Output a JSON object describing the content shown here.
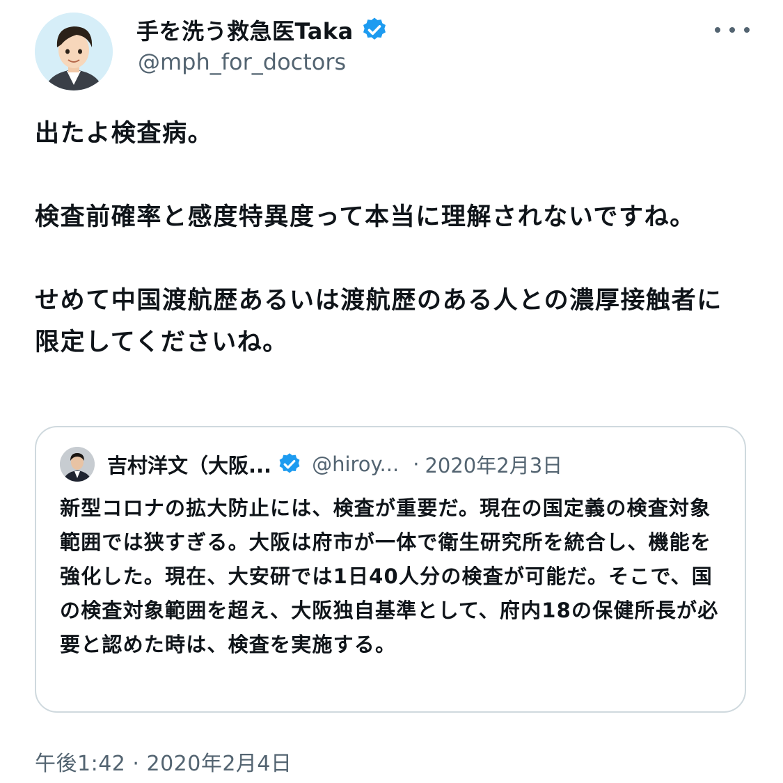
{
  "author": {
    "display_name": "手を洗う救急医Taka",
    "handle": "@mph_for_doctors",
    "verified": true,
    "verified_color": "#1d9bf0"
  },
  "tweet": {
    "paragraphs": [
      "出たよ検査病。",
      "検査前確率と感度特異度って本当に理解されないですね。",
      "せめて中国渡航歴あるいは渡航歴のある人との濃厚接触者に限定してくださいね。"
    ],
    "timestamp": "午後1:42 · 2020年2月4日"
  },
  "quoted_tweet": {
    "display_name": "吉村洋文（大阪...",
    "handle": "@hiroy...",
    "separator": "·",
    "date": "2020年2月3日",
    "text": "新型コロナの拡大防止には、検査が重要だ。現在の国定義の検査対象範囲では狭すぎる。大阪は府市が一体で衛生研究所を統合し、機能を強化した。現在、大安研では1日40人分の検査が可能だ。そこで、国の検査対象範囲を超え、大阪独自基準として、府内18の保健所長が必要と認めた時は、検査を実施する。"
  },
  "icons": {
    "more": "more-horizontal-icon",
    "verified": "verified-badge-icon"
  },
  "colors": {
    "text_primary": "#0f1419",
    "text_secondary": "#536471",
    "border": "#cfd9de",
    "accent": "#1d9bf0"
  }
}
